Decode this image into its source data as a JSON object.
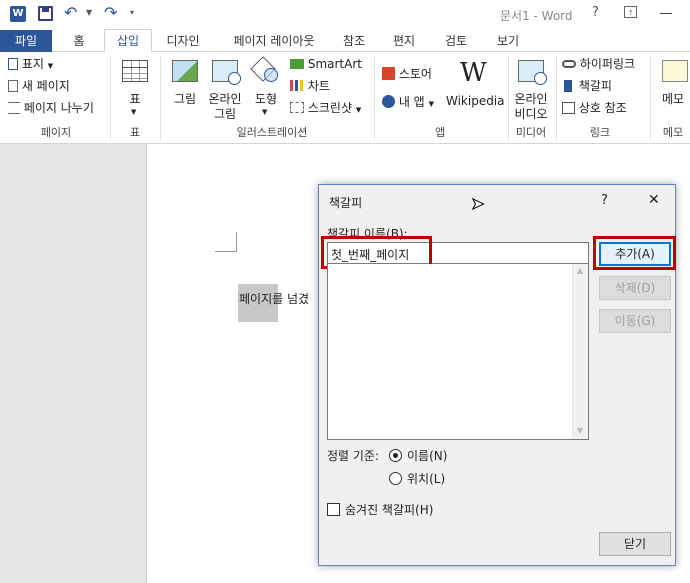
{
  "window": {
    "title": "문서1 - Word"
  },
  "tabs": [
    "파일",
    "홈",
    "삽입",
    "디자인",
    "페이지 레이아웃",
    "참조",
    "편지",
    "검토",
    "보기"
  ],
  "ribbon": {
    "pages": {
      "cover": "표지",
      "blank": "새 페이지",
      "break": "페이지 나누기",
      "group": "페이지"
    },
    "table": {
      "label": "표",
      "group": "표"
    },
    "illustrations": {
      "pictures": "그림",
      "online1": "온라인",
      "online2": "그림",
      "shapes": "도형",
      "smartart": "SmartArt",
      "chart": "차트",
      "screenshot": "스크린샷",
      "group": "일러스트레이션"
    },
    "apps": {
      "store": "스토어",
      "myapps": "내 앱",
      "wikipedia": "Wikipedia",
      "wiki_glyph": "W",
      "group": "앱"
    },
    "media": {
      "video1": "온라인",
      "video2": "비디오",
      "group": "미디어"
    },
    "links": {
      "hyperlink": "하이퍼링크",
      "bookmark": "책갈피",
      "crossref": "상호 참조",
      "group": "링크"
    },
    "comments": {
      "comment": "메모",
      "group": "메모"
    }
  },
  "document": {
    "text": "페이지를 넘겼"
  },
  "dialog": {
    "title": "책갈피",
    "help": "?",
    "close": "✕",
    "name_label": "책갈피 이름(B):",
    "name_value": "첫_번째_페이지",
    "add": "추가(A)",
    "delete": "삭제(D)",
    "goto": "이동(G)",
    "sort_label": "정렬 기준:",
    "sort_name": "이름(N)",
    "sort_location": "위치(L)",
    "hidden": "숨겨진 책갈피(H)",
    "close_btn": "닫기"
  },
  "colors": {
    "accent": "#2b579a",
    "highlight": "#c00000"
  }
}
